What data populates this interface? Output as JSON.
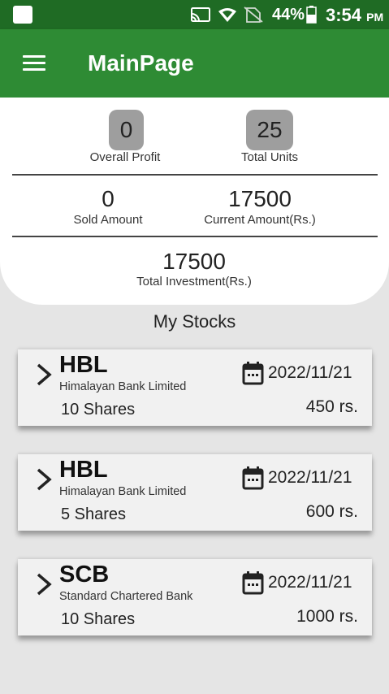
{
  "status_bar": {
    "battery": "44%",
    "time": "3:54",
    "ampm": "PM",
    "icons": [
      "notification-icon",
      "cast-icon",
      "wifi-icon",
      "no-sim-icon",
      "battery-icon"
    ]
  },
  "app_bar": {
    "title": "MainPage",
    "menu_icon": "hamburger-menu-icon"
  },
  "summary": {
    "overall_profit": {
      "value": "0",
      "label": "Overall Profit"
    },
    "total_units": {
      "value": "25",
      "label": "Total Units"
    },
    "sold_amount": {
      "value": "0",
      "label": "Sold Amount"
    },
    "current_amount": {
      "value": "17500",
      "label": "Current Amount(Rs.)"
    },
    "total_investment": {
      "value": "17500",
      "label": "Total Investment(Rs.)"
    }
  },
  "stocks": {
    "title": "My Stocks",
    "items": [
      {
        "symbol": "HBL",
        "name": "Himalayan Bank Limited",
        "shares": "10 Shares",
        "date": "2022/11/21",
        "price": "450 rs."
      },
      {
        "symbol": "HBL",
        "name": "Himalayan Bank Limited",
        "shares": "5 Shares",
        "date": "2022/11/21",
        "price": "600 rs."
      },
      {
        "symbol": "SCB",
        "name": "Standard Chartered Bank",
        "shares": "10 Shares",
        "date": "2022/11/21",
        "price": "1000 rs."
      }
    ]
  },
  "colors": {
    "status_bar": "#1f6b24",
    "app_bar": "#2e8b34",
    "chip": "#9e9e9e",
    "background": "#e5e5e5"
  }
}
